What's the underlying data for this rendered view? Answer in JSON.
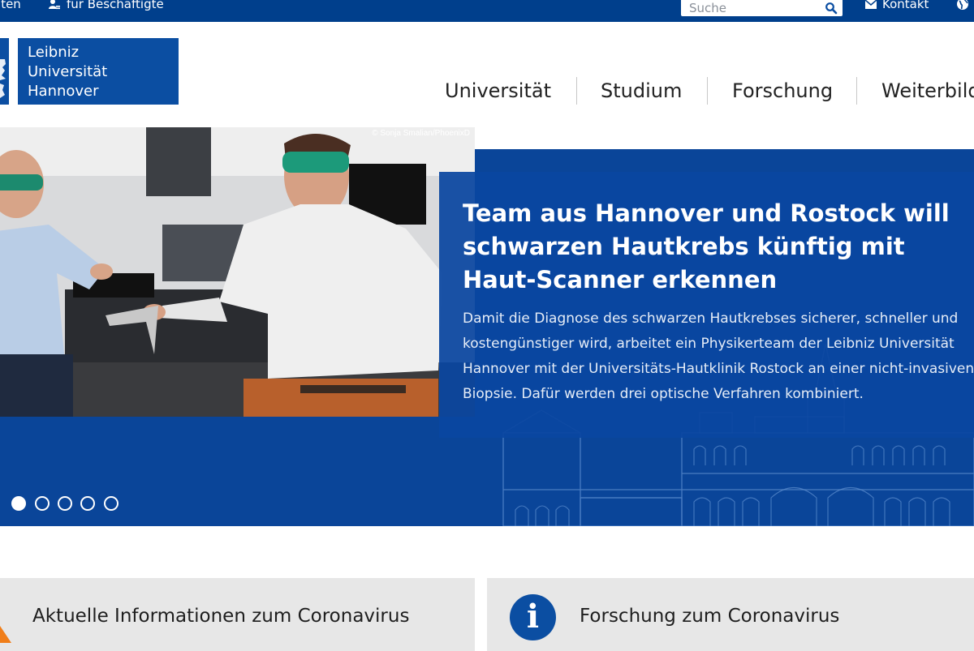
{
  "topbar": {
    "clip_left": "äten",
    "employees_label": "für Beschäftigte",
    "search_placeholder": "Suche",
    "contact_label": "Kontakt"
  },
  "logo": {
    "line1": "Leibniz",
    "line2": "Universität",
    "line3": "Hannover"
  },
  "nav": {
    "items": [
      "Universität",
      "Studium",
      "Forschung",
      "Weiterbildung"
    ]
  },
  "hero": {
    "photo_credit": "© Sonja Smalian/PhoenixD",
    "headline": "Team aus Hannover und Rostock will schwarzen Hautkrebs künftig mit Haut-Scanner erkennen",
    "body": "Damit die Diagnose des schwarzen Hautkrebses sicherer, schneller und\nkostengünstiger wird, arbeitet ein Physikerteam der Leibniz Universität\nHannover mit der Universitäts-Hautklinik Rostock an einer nicht-invasiven\nBiopsie. Dafür werden drei optische Verfahren kombiniert.",
    "slides_total": 5,
    "active_slide": 1
  },
  "cards": {
    "left_title": "Aktuelle Informationen zum Coronavirus",
    "right_title": "Forschung zum Coronavirus"
  },
  "colors": {
    "brand_blue": "#003f8c",
    "hero_blue": "#0a4599",
    "card_grey": "#e7e7e7",
    "warning_orange": "#f07e1a"
  }
}
